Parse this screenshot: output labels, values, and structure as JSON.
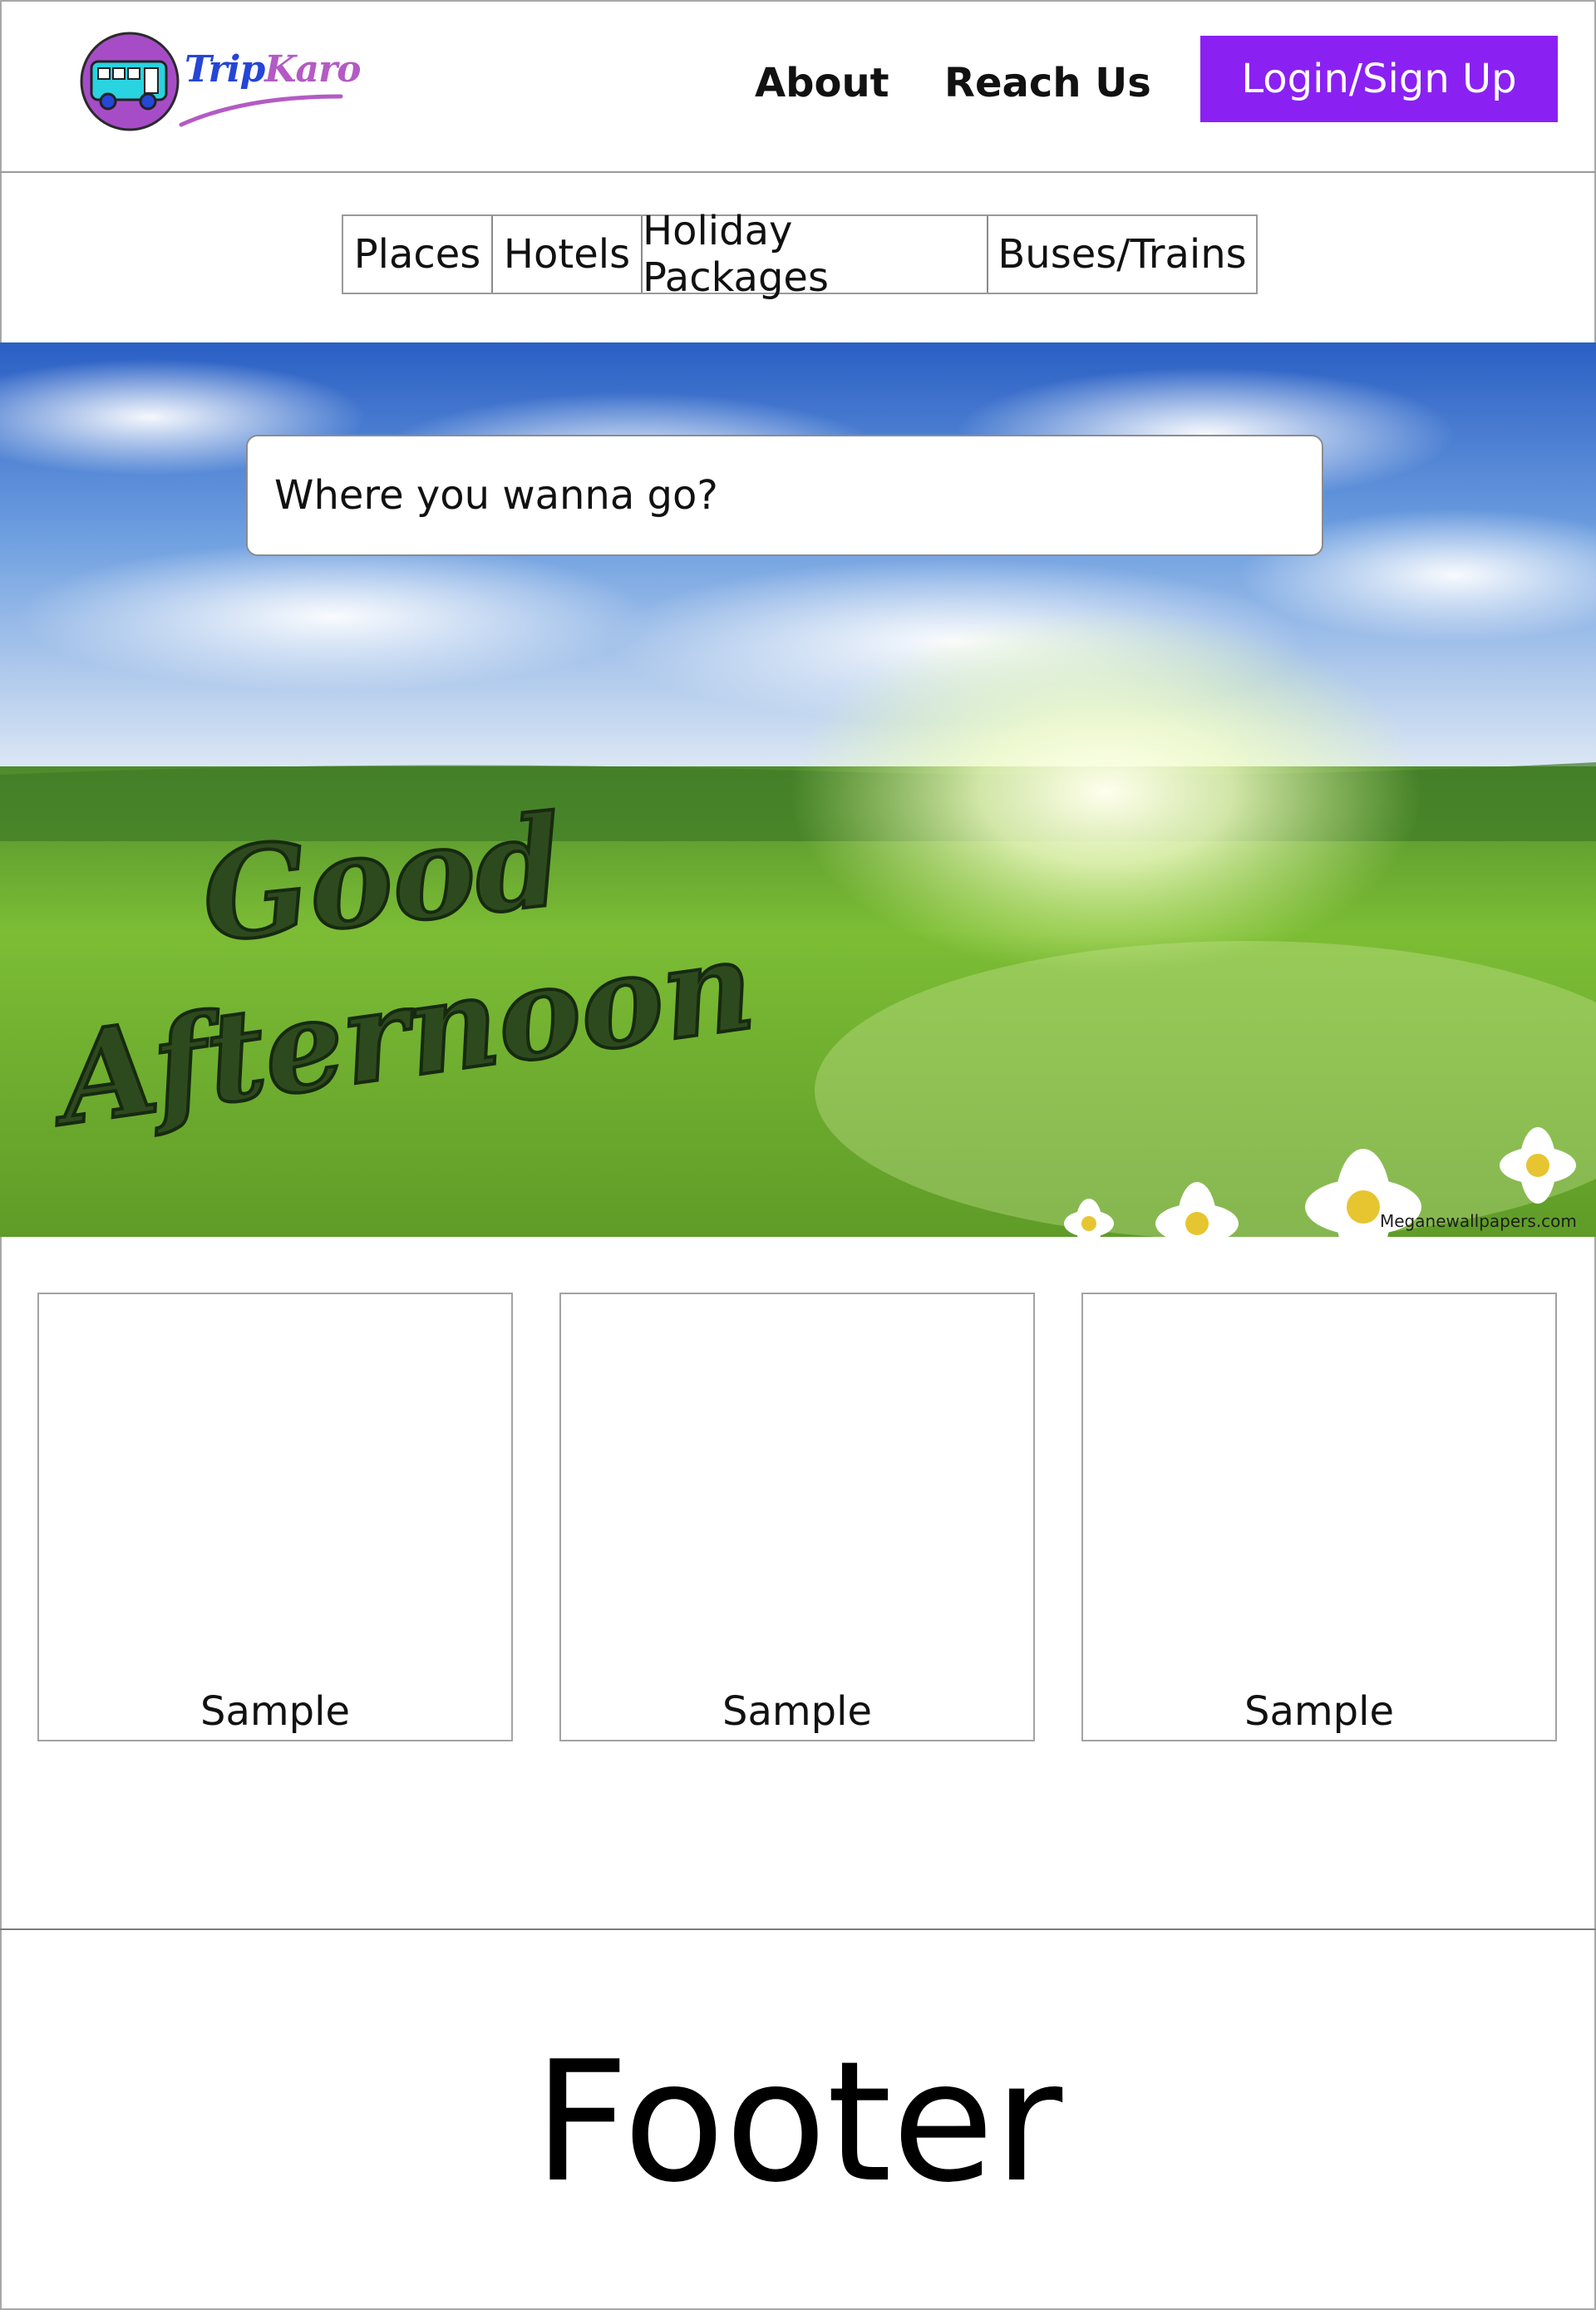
{
  "header": {
    "logo": {
      "brand_part1": "Trip",
      "brand_part2": "Karo",
      "icon": "bus-icon"
    },
    "nav": [
      {
        "label": "About"
      },
      {
        "label": "Reach Us"
      }
    ],
    "login_label": "Login/Sign Up"
  },
  "tabs": [
    {
      "label": "Places"
    },
    {
      "label": "Hotels"
    },
    {
      "label": "Holiday Packages"
    },
    {
      "label": "Buses/Trains"
    }
  ],
  "hero": {
    "search_placeholder": "Where you wanna go?",
    "greeting_line1": "Good",
    "greeting_line2": "Afternoon",
    "watermark": "Meganewallpapers.com"
  },
  "cards": [
    {
      "label": "Sample"
    },
    {
      "label": "Sample"
    },
    {
      "label": "Sample"
    }
  ],
  "footer": {
    "label": "Footer"
  },
  "colors": {
    "accent": "#8a21f2",
    "logo_blue": "#2546d6",
    "logo_pink": "#b45ac4",
    "logo_circle": "#a74cc7",
    "bus_body": "#29d3e0"
  }
}
